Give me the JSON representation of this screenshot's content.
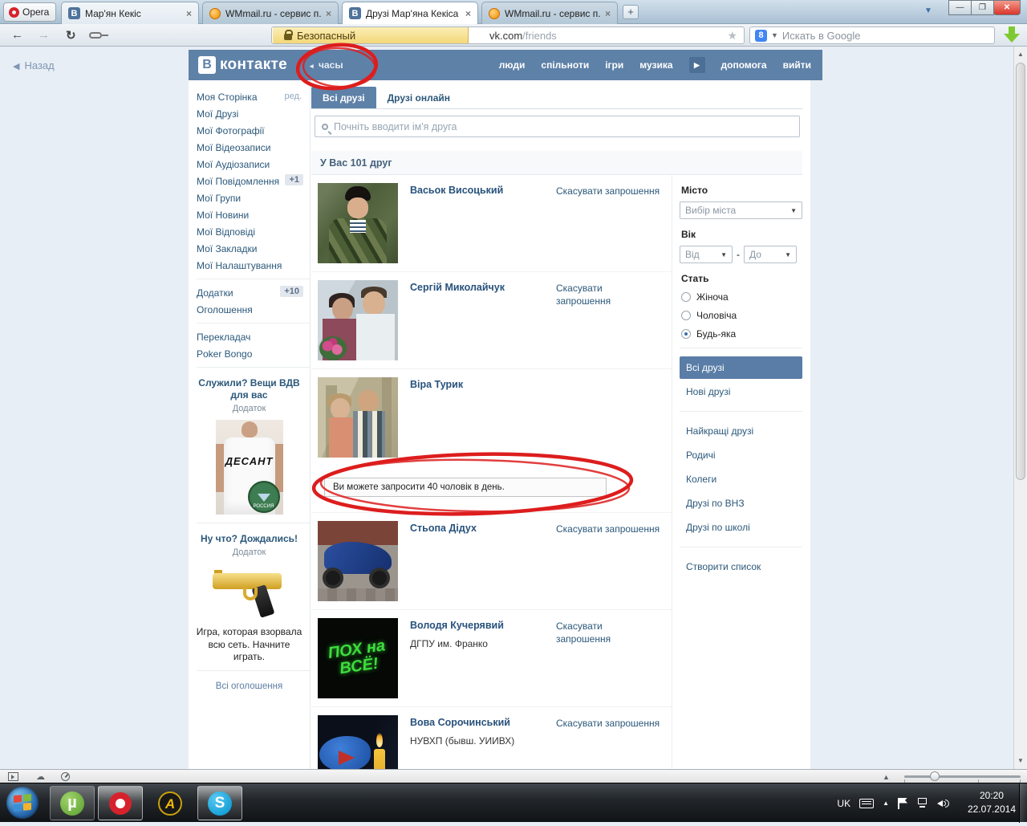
{
  "browser": {
    "opera_label": "Opera",
    "tabs": [
      {
        "title": "Мар'ян Кекіс"
      },
      {
        "title": "WMmail.ru - сервис п..."
      },
      {
        "title": "Друзі Мар'яна Кекіса |..."
      },
      {
        "title": "WMmail.ru - сервис п..."
      }
    ],
    "close_glyph": "×",
    "new_tab": "+",
    "security_badge": "Безопасный",
    "url_host": "vk.com",
    "url_path": "/friends",
    "search_placeholder": "Искать в Google",
    "google_glyph": "8"
  },
  "vk_header": {
    "back_label": "Назад",
    "logo_letter": "В",
    "logo_text": "контакте",
    "watch_item": "часы",
    "menu": [
      "люди",
      "спільноти",
      "ігри",
      "музика",
      "допомога",
      "вийти"
    ]
  },
  "left_nav": {
    "items": [
      {
        "label": "Моя Сторінка",
        "extra": "ред."
      },
      {
        "label": "Мої Друзі"
      },
      {
        "label": "Мої Фотографії"
      },
      {
        "label": "Мої Відеозаписи"
      },
      {
        "label": "Мої Аудіозаписи"
      },
      {
        "label": "Мої Повідомлення",
        "badge": "+1"
      },
      {
        "label": "Мої Групи"
      },
      {
        "label": "Мої Новини"
      },
      {
        "label": "Мої Відповіді"
      },
      {
        "label": "Мої Закладки"
      },
      {
        "label": "Мої Налаштування"
      }
    ],
    "apps_label": "Додатки",
    "apps_badge": "+10",
    "announcements": "Оголошення",
    "translator": "Перекладач",
    "poker": "Poker Bongo",
    "ad1": {
      "title": "Служили? Вещи ВДВ для вас",
      "type": "Додаток",
      "shirt_text": "ДЕСАНТ",
      "badge_text": "РОССИЯ"
    },
    "ad2": {
      "title": "Ну что? Дождались!",
      "type": "Додаток",
      "caption": "Игра, которая взорвала всю сеть. Начните играть."
    },
    "all_ads": "Всі оголошення"
  },
  "friends_page": {
    "tab_all": "Всі друзі",
    "tab_online": "Друзі онлайн",
    "search_placeholder": "Почніть вводити ім'я друга",
    "counter": "У Вас 101 друг",
    "notice": "Ви можете запросити 40 чоловік в день.",
    "friends": [
      {
        "name": "Васьок Висоцький",
        "sub": "",
        "cancel": "Скасувати запрошення"
      },
      {
        "name": "Сергій Миколайчук",
        "sub": "",
        "cancel": "Скасувати запрошення"
      },
      {
        "name": "Віра Турик",
        "sub": "",
        "cancel": ""
      },
      {
        "name": "Стьопа Дідух",
        "sub": "",
        "cancel": "Скасувати запрошення"
      },
      {
        "name": "Володя Кучерявий",
        "sub": "ДГПУ им. Франко",
        "cancel": "Скасувати запрошення",
        "photo_text": "ПОХ на ВСЁ!"
      },
      {
        "name": "Вова Сорочинський",
        "sub": "НУВХП (бывш. УИИВХ)",
        "cancel": "Скасувати запрошення"
      }
    ]
  },
  "filters": {
    "city_label": "Місто",
    "city_value": "Вибір міста",
    "age_label": "Вік",
    "age_from": "Від",
    "age_dash": "-",
    "age_to": "До",
    "gender_label": "Стать",
    "gender_options": [
      "Жіноча",
      "Чоловіча",
      "Будь-яка"
    ],
    "list_all": "Всі друзі",
    "list_new": "Нові друзі",
    "lists": [
      "Найкращі друзі",
      "Родичі",
      "Колеги",
      "Друзі по ВНЗ",
      "Друзі по школі"
    ],
    "create_list": "Створити список"
  },
  "taskbar": {
    "lang": "UK",
    "time": "20:20",
    "date": "22.07.2014"
  }
}
